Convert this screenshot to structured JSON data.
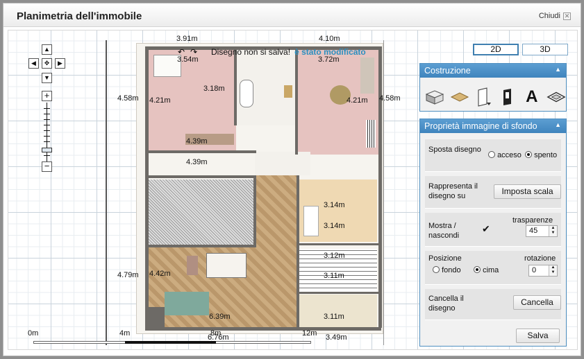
{
  "window": {
    "title": "Planimetria dell'immobile",
    "close_label": "Chiudi",
    "close_icon": "x-icon"
  },
  "status": {
    "text": "Disegno non si salva!",
    "modified": "è stato modificato"
  },
  "dimensions": {
    "top_left": "3.91m",
    "top_right": "4.10m",
    "bedroom_top": "3.54m",
    "bedroom_left_outer": "4.58m",
    "bedroom_left_inner": "4.21m",
    "bedroom_mid": "3.18m",
    "bedroom_bottom": "4.39m",
    "living_top": "3.72m",
    "living_right_inner": "4.21m",
    "living_right_outer": "4.58m",
    "room2_top": "4.39m",
    "room3": "3.14m",
    "stair_top": "3.14m",
    "stair_bottom": "3.12m",
    "room4_top": "3.11m",
    "room4_bottom": "3.11m",
    "big_left_outer": "4.79m",
    "big_left_inner": "4.42m",
    "big_bottom": "6.39m",
    "bottom_total": "6.76m",
    "bottom_right": "3.49m"
  },
  "scale": {
    "labels": [
      "0m",
      "4m",
      "8m",
      "12m"
    ]
  },
  "view_toggle": {
    "two_d": "2D",
    "three_d": "3D",
    "active": "2D"
  },
  "construction_panel": {
    "title": "Costruzione",
    "tools": [
      "wall-tool-icon",
      "floor-tool-icon",
      "door-tool-icon",
      "window-tool-icon",
      "text-tool-icon",
      "dimension-tool-icon"
    ]
  },
  "background_panel": {
    "title": "Proprietà immagine di sfondo",
    "move_label": "Sposta disegno",
    "move_on": "acceso",
    "move_off": "spento",
    "move_selected": "spento",
    "scale_label": "Rappresenta il disegno su",
    "scale_button": "Imposta scala",
    "show_label": "Mostra / nascondi",
    "show_checked": true,
    "transparency_label": "trasparenze",
    "transparency_value": "45",
    "position_label": "Posizione",
    "rotation_label": "rotazione",
    "pos_back": "fondo",
    "pos_top": "cima",
    "pos_selected": "cima",
    "rotation_value": "0",
    "delete_label": "Cancella il disegno",
    "delete_button": "Cancella",
    "save_button": "Salva"
  },
  "colors": {
    "accent": "#3f84bd",
    "modified": "#2c8fbf",
    "bedroom": "#e8c4c2",
    "living": "#e8c4c2",
    "parquet": "#b89568",
    "wood_light": "#e3c89a"
  }
}
